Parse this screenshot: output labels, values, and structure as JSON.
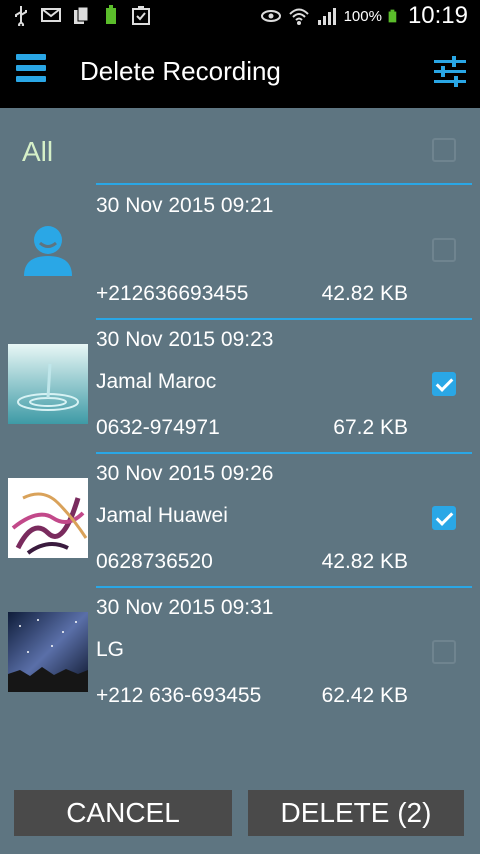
{
  "status_bar": {
    "battery_percent": "100%",
    "time": "10:19",
    "icons": [
      "usb-icon",
      "mail-icon",
      "sim-icon",
      "battery-small-icon",
      "clipboard-icon",
      "eye-icon",
      "wifi-icon",
      "signal-icon",
      "battery-icon"
    ]
  },
  "action_bar": {
    "title": "Delete Recording",
    "left_icon": "menu-icon",
    "right_icon": "tune-icon"
  },
  "all_row": {
    "label": "All",
    "checked": false
  },
  "recordings": [
    {
      "date": "30 Nov 2015  09:21",
      "name": "",
      "number": "+212636693455",
      "size": "42.82 KB",
      "checked": false,
      "thumb": "contact-placeholder-icon"
    },
    {
      "date": "30 Nov 2015  09:23",
      "name": "Jamal Maroc",
      "number": "0632-974971",
      "size": "67.2 KB",
      "checked": true,
      "thumb": "water-drop-photo"
    },
    {
      "date": "30 Nov 2015  09:26",
      "name": "Jamal Huawei",
      "number": "0628736520",
      "size": "42.82 KB",
      "checked": true,
      "thumb": "ink-smoke-photo"
    },
    {
      "date": "30 Nov 2015  09:31",
      "name": "LG",
      "number": "+212 636-693455",
      "size": "62.42 KB",
      "checked": false,
      "thumb": "night-sky-photo"
    }
  ],
  "buttons": {
    "cancel": "CANCEL",
    "delete": "DELETE (2)"
  },
  "colors": {
    "accent": "#2aa7e6",
    "background": "#5e7581",
    "all_label": "#d6f0c8",
    "button_bg": "#4a4a4a"
  }
}
